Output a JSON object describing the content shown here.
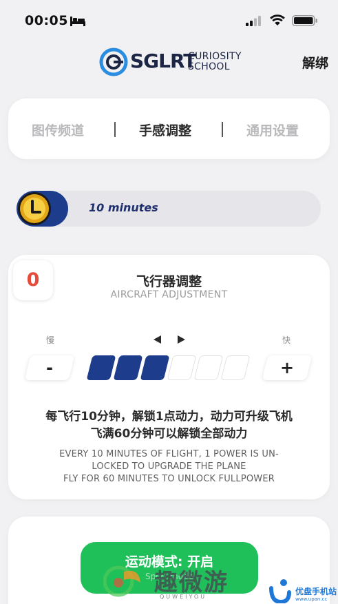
{
  "status_bar": {
    "time": "00:05"
  },
  "header": {
    "logo_main": "SGLRT",
    "logo_sub_line1": "CURIOSITY",
    "logo_sub_line2": "SCHOOL",
    "unbind_label": "解绑"
  },
  "tabs": [
    {
      "label": "图传频道",
      "active": false
    },
    {
      "label": "手感调整",
      "active": true
    },
    {
      "label": "通用设置",
      "active": false
    }
  ],
  "timer": {
    "text": "10 minutes",
    "progress_fraction": 0.17
  },
  "adjustment": {
    "power_value": "0",
    "title": "飞行器调整",
    "subtitle": "AIRCRAFT ADJUSTMENT",
    "slow_label": "慢",
    "fast_label": "快",
    "minus_label": "-",
    "plus_label": "+",
    "level": 3,
    "max_level": 6,
    "desc_cn_line1": "每飞行10分钟，解锁1点动力，动力可升级飞机",
    "desc_cn_line2": "飞满60分钟可以解锁全部动力",
    "desc_en_line1": "EVERY 10 MINUTES OF FLIGHT, 1 POWER IS UN-",
    "desc_en_line2": "LOCKED TO UPGRADE THE PLANE",
    "desc_en_line3": "FLY FOR 60 MINUTES TO UNLOCK FULLPOWER"
  },
  "mode": {
    "label": "运动模式: 开启",
    "sublabel": "Sport mode"
  },
  "watermark": {
    "text": "趣微游",
    "sub": "QUWEIYOU",
    "site_name": "优盘手机站",
    "site_url": "www.upan.cc"
  },
  "colors": {
    "accent_blue": "#1e3c8c",
    "mode_green": "#1fc05a",
    "power_red": "#e84a3a",
    "background": "#f1f1f3"
  }
}
